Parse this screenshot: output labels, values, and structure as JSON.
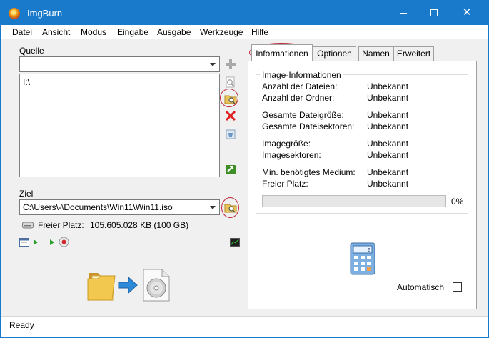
{
  "window": {
    "title": "ImgBurn"
  },
  "menu": [
    "Datei",
    "Ansicht",
    "Modus",
    "Eingabe",
    "Ausgabe",
    "Werkzeuge",
    "Hilfe"
  ],
  "source": {
    "group_label": "Quelle",
    "selected": "",
    "list_items": [
      "I:\\"
    ]
  },
  "destination": {
    "group_label": "Ziel",
    "path": "C:\\Users\\-\\Documents\\Win11\\Win11.iso",
    "free_label": "Freier Platz:",
    "free_value": "105.605.028 KB  (100 GB)"
  },
  "tabs": [
    "Informationen",
    "Optionen",
    "Namen",
    "Erweitert"
  ],
  "active_tab": "Informationen",
  "info": {
    "legend": "Image-Informationen",
    "rows": [
      {
        "key": "Anzahl der Dateien:",
        "value": "Unbekannt"
      },
      {
        "key": "Anzahl der Ordner:",
        "value": "Unbekannt"
      },
      {
        "key": "Gesamte Dateigröße:",
        "value": "Unbekannt"
      },
      {
        "key": "Gesamte Dateisektoren:",
        "value": "Unbekannt"
      },
      {
        "key": "Imagegröße:",
        "value": "Unbekannt"
      },
      {
        "key": "Imagesektoren:",
        "value": "Unbekannt"
      },
      {
        "key": "Min. benötigtes Medium:",
        "value": "Unbekannt"
      },
      {
        "key": "Freier Platz:",
        "value": "Unbekannt"
      }
    ],
    "progress_label": "0%",
    "progress_fraction": 0,
    "automatic_label": "Automatisch",
    "automatic_checked": false
  },
  "status": {
    "text": "Ready"
  },
  "colors": {
    "titlebar": "#1979ca",
    "highlight_circle": "#c0283a"
  },
  "icons": [
    "imgburn-app-icon",
    "add-icon",
    "search-file-icon",
    "browse-folder-icon",
    "delete-icon",
    "recycle-icon",
    "go-icon",
    "drive-icon",
    "log-window-icon",
    "graph-icon",
    "folder-icon",
    "arrow-right-icon",
    "disc-image-icon",
    "calculator-icon"
  ]
}
